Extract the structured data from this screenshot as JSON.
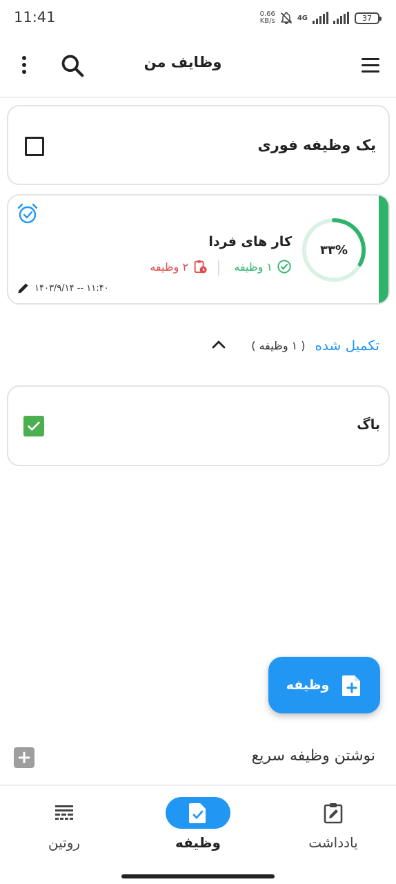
{
  "status_bar": {
    "time": "11:41",
    "net_speed_value": "0.66",
    "net_speed_unit": "KB/s",
    "network": "4G",
    "battery": "37"
  },
  "app_bar": {
    "title": "وظایف من"
  },
  "tasks": [
    {
      "title": "یک وظیفه فوری",
      "checked": false
    }
  ],
  "task_list": {
    "title": "کار های فردا",
    "progress_label": "۳۳%",
    "progress_value": 0.33,
    "done_count": "۱ وظیفه",
    "pending_count": "۲ وظیفه",
    "edited_at": "۱۴۰۳/۹/۱۴ -- ۱۱:۴۰",
    "accent_color": "#2fb36b"
  },
  "completed": {
    "label": "تکمیل شده",
    "count": "( ۱ وظیفه )",
    "items": [
      {
        "title": "باگ",
        "checked": true
      }
    ]
  },
  "fab": {
    "label": "وظیفه"
  },
  "quick_add": {
    "placeholder": "نوشتن وظیفه سریع"
  },
  "bottom_nav": {
    "items": [
      {
        "label": "یادداشت",
        "icon": "note-edit-icon",
        "active": false
      },
      {
        "label": "وظیفه",
        "icon": "task-file-icon",
        "active": true
      },
      {
        "label": "روتین",
        "icon": "routine-icon",
        "active": false
      }
    ]
  },
  "colors": {
    "primary": "#2196f3",
    "success": "#2fb36b",
    "danger": "#e04a4a"
  }
}
